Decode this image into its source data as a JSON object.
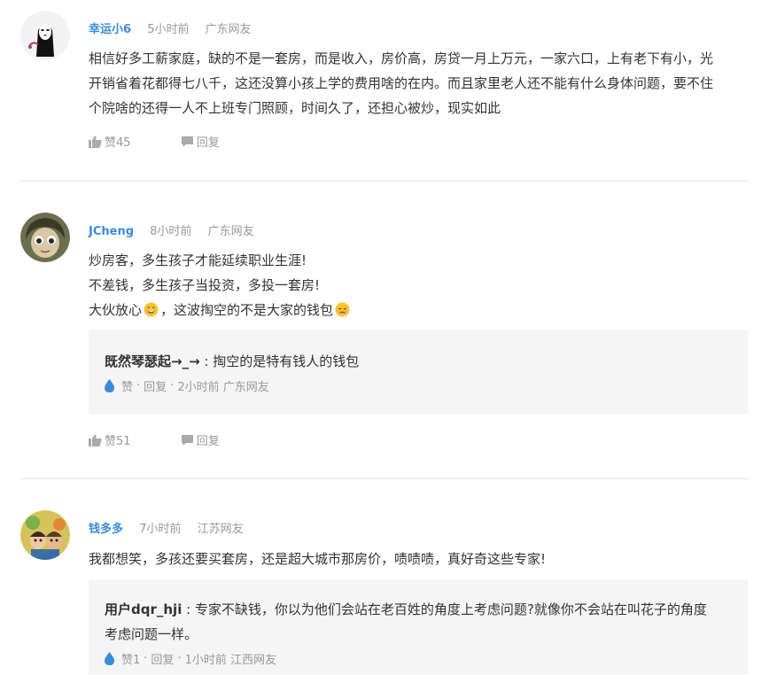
{
  "comments": [
    {
      "username": "幸运小6",
      "time": "5小时前",
      "location": "广东网友",
      "lines": [
        "相信好多工薪家庭，缺的不是一套房，而是收入，房价高，房贷一月上万元，一家六口，上有老下有小，光",
        "开销省着花都得七八千，这还没算小孩上学的费用啥的在内。而且家里老人还不能有什么身体问题，要不住",
        "个院啥的还得一人不上班专门照顾，时间久了，还担心被炒，现实如此"
      ],
      "like_label": "赞45",
      "reply_label": "回复"
    },
    {
      "username": "JCheng",
      "time": "8小时前",
      "location": "广东网友",
      "lines": [
        "炒房客，多生孩子才能延续职业生涯!",
        "不差钱，多生孩子当投资，多投一套房!"
      ],
      "line3_a": "大伙放心",
      "line3_b": "，这波掏空的不是大家的钱包",
      "reply": {
        "user": "既然琴瑟起→_→",
        "text": " : 掏空的是特有钱人的钱包",
        "like": "赞",
        "sep": "·",
        "reply": "回复",
        "tail": "2小时前 广东网友"
      },
      "like_label": "赞51",
      "reply_label": "回复"
    },
    {
      "username": "钱多多",
      "time": "7小时前",
      "location": "江苏网友",
      "lines": [
        "我都想笑，多孩还要买套房，还是超大城市那房价，啧啧啧，真好奇这些专家!"
      ],
      "reply": {
        "user": "用户dqr_hji",
        "text_1": " : 专家不缺钱，你以为他们会站在老百姓的角度上考虑问题?就像你不会站在叫花子的角度",
        "text_2": "考虑问题一样。",
        "like": "赞1",
        "sep": "·",
        "reply": "回复",
        "tail": "1小时前 江西网友"
      }
    }
  ],
  "colors": {
    "username": "#3a8bd9",
    "meta": "#999999",
    "text": "#333333",
    "reply_bg": "#f5f5f5",
    "divider": "#e8e8e8",
    "drop_icon": "#3a8bd9"
  },
  "icons": [
    "thumbs-up-icon",
    "chat-bubble-icon",
    "water-drop-icon",
    "smile-emoji",
    "pensive-emoji"
  ]
}
